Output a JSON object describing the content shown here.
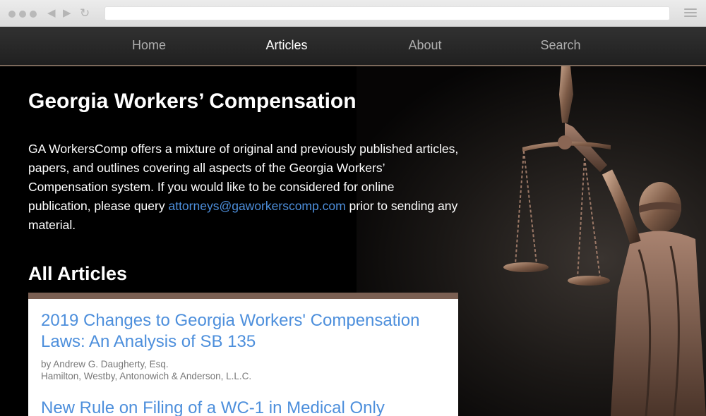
{
  "browser": {
    "url": "",
    "controls": [
      "back-arrow-icon",
      "forward-arrow-icon",
      "reload-icon",
      "menu-icon"
    ]
  },
  "nav": {
    "items": [
      {
        "label": "Home",
        "active": false
      },
      {
        "label": "Articles",
        "active": true
      },
      {
        "label": "About",
        "active": false
      },
      {
        "label": "Search",
        "active": false
      }
    ]
  },
  "hero": {
    "title": "Georgia Workers’ Compensation",
    "intro_before": "GA WorkersComp offers a mixture of original and previously published articles, papers, and outlines covering all aspects of the Georgia Workers’ Compensation system. If you would like to be considered for online publication, please query ",
    "intro_email": "attorneys@gaworkerscomp.com",
    "intro_after": " prior to sending any material."
  },
  "articles_section": {
    "title": "All Articles",
    "items": [
      {
        "title": "2019 Changes to Georgia Workers' Compensation Laws: An Analysis of SB 135",
        "author": "by Andrew G. Daugherty, Esq.",
        "firm": "Hamilton, Westby, Antonowich & Anderson, L.L.C."
      },
      {
        "title": "New Rule on Filing of a WC-1 in Medical Only",
        "author": "",
        "firm": ""
      }
    ]
  },
  "colors": {
    "link": "#4d8fdc",
    "panel_accent": "#7a5f52",
    "nav_active": "#ffffff",
    "nav_inactive": "#aeaeae"
  }
}
